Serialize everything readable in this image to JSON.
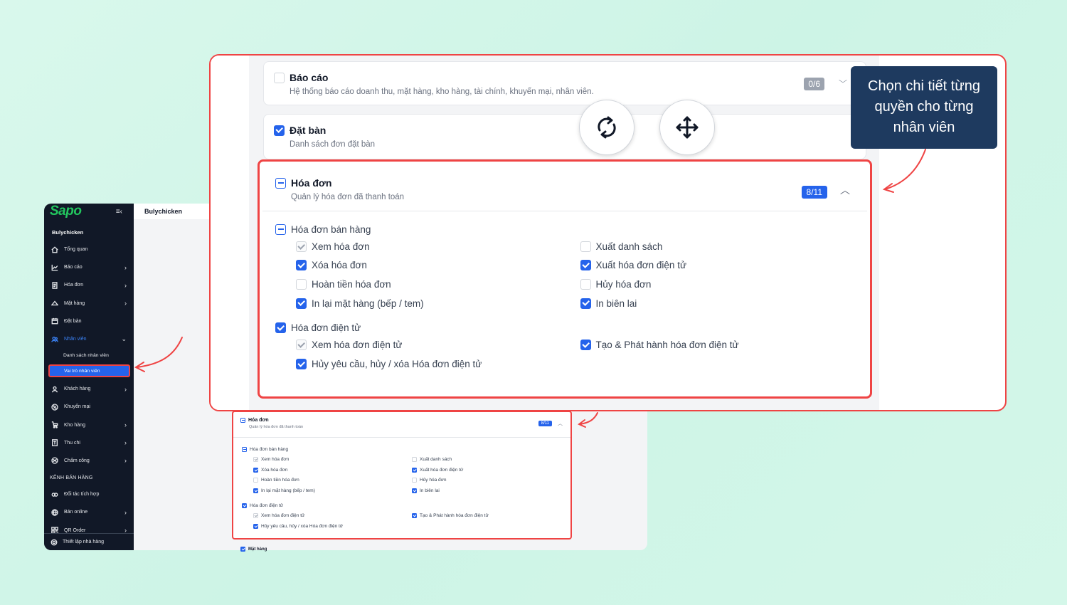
{
  "sidebar": {
    "logo": "Sapo",
    "store_name": "Bulychicken",
    "items": [
      {
        "label": "Tổng quan",
        "icon": "home-icon",
        "chevron": false
      },
      {
        "label": "Báo cáo",
        "icon": "chart-icon",
        "chevron": true
      },
      {
        "label": "Hóa đơn",
        "icon": "receipt-icon",
        "chevron": true
      },
      {
        "label": "Mặt hàng",
        "icon": "tag-icon",
        "chevron": true
      },
      {
        "label": "Đặt bàn",
        "icon": "calendar-icon",
        "chevron": false
      },
      {
        "label": "Nhân viên",
        "icon": "users-icon",
        "chevron": true,
        "active": true
      }
    ],
    "sub_items": [
      "Danh sách nhân viên",
      "Vai trò nhân viên"
    ],
    "items2": [
      {
        "label": "Khách hàng",
        "icon": "user-icon",
        "chevron": true
      },
      {
        "label": "Khuyến mại",
        "icon": "percent-icon",
        "chevron": false
      },
      {
        "label": "Kho hàng",
        "icon": "box-icon",
        "chevron": true
      },
      {
        "label": "Thu chi",
        "icon": "wallet-icon",
        "chevron": true
      },
      {
        "label": "Chấm công",
        "icon": "clock-icon",
        "chevron": true
      }
    ],
    "section_label": "KÊNH BÁN HÀNG",
    "items3": [
      {
        "label": "Đối tác tích hợp",
        "icon": "partner-icon",
        "chevron": false
      },
      {
        "label": "Bán online",
        "icon": "globe-icon",
        "chevron": true
      },
      {
        "label": "QR Order",
        "icon": "qr-icon",
        "chevron": true
      }
    ],
    "footer": "Thiết lập nhà hàng"
  },
  "topbar": {
    "title": "Bulychicken"
  },
  "small_panel": {
    "title": "Hóa đơn",
    "subtitle": "Quản lý hóa đơn đã thanh toán",
    "badge": "8/11",
    "groups": [
      {
        "label": "Hóa đơn bán hàng",
        "state": "indeterminate",
        "rows": [
          [
            {
              "label": "Xem hóa đơn",
              "state": "disabled"
            },
            {
              "label": "Xuất danh sách",
              "state": "off"
            }
          ],
          [
            {
              "label": "Xóa hóa đơn",
              "state": "on"
            },
            {
              "label": "Xuất hóa đơn điện tử",
              "state": "on"
            }
          ],
          [
            {
              "label": "Hoàn tiền hóa đơn",
              "state": "off"
            },
            {
              "label": "Hủy hóa đơn",
              "state": "off"
            }
          ],
          [
            {
              "label": "In lại mặt hàng (bếp / tem)",
              "state": "on"
            },
            {
              "label": "In biên lai",
              "state": "on"
            }
          ]
        ]
      },
      {
        "label": "Hóa đơn điện tử",
        "state": "on",
        "rows": [
          [
            {
              "label": "Xem hóa đơn điện tử",
              "state": "disabled"
            },
            {
              "label": "Tạo & Phát hành hóa đơn điện tử",
              "state": "on"
            }
          ],
          [
            {
              "label": "Hủy yêu cầu, hủy / xóa Hóa đơn điện tử",
              "state": "on"
            },
            null
          ]
        ]
      }
    ],
    "next_label": "Mặt hàng"
  },
  "zoom": {
    "bao_cao": {
      "title": "Báo cáo",
      "subtitle": "Hệ thống báo cáo doanh thu, mặt hàng, kho hàng, tài chính, khuyến mại, nhân viên.",
      "badge": "0/6"
    },
    "dat_ban": {
      "title": "Đặt bàn",
      "subtitle": "Danh sách đơn đặt bàn"
    },
    "hoa_don": {
      "title": "Hóa đơn",
      "subtitle": "Quản lý hóa đơn đã thanh toán",
      "badge": "8/11"
    }
  },
  "tooltip": {
    "lines": [
      "Chọn chi tiết từng",
      "quyền cho từng",
      "nhân viên"
    ]
  },
  "colors": {
    "accent": "#2563eb",
    "highlight": "#ef4444",
    "sidebar_bg": "#111827",
    "tooltip_bg": "#1e3a5f"
  }
}
